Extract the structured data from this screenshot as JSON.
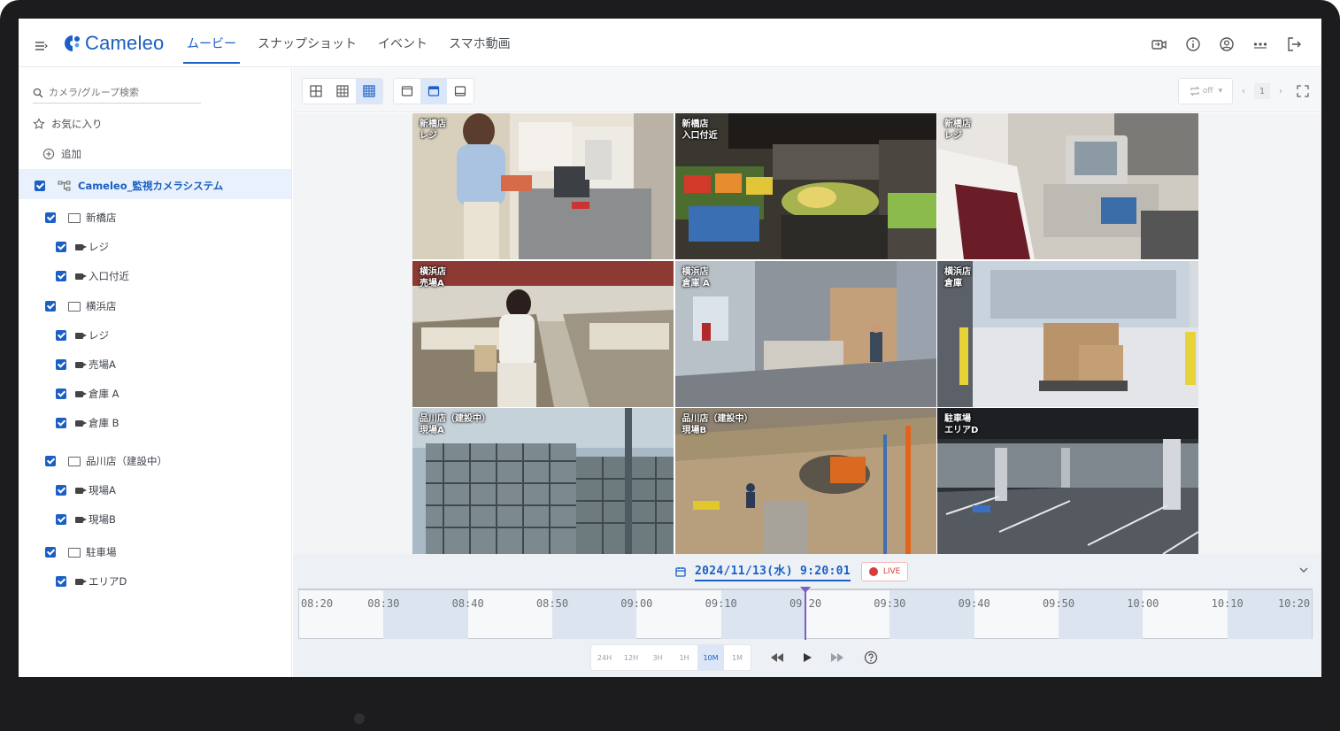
{
  "app": {
    "logo_text": "Cameleo"
  },
  "nav": {
    "tabs": [
      {
        "label": "ムービー",
        "active": true
      },
      {
        "label": "スナップショット",
        "active": false
      },
      {
        "label": "イベント",
        "active": false
      },
      {
        "label": "スマホ動画",
        "active": false
      }
    ]
  },
  "header_icons": [
    "camera-switch-icon",
    "info-icon",
    "account-icon",
    "more-icon",
    "logout-icon"
  ],
  "sidebar": {
    "search_placeholder": "カメラ/グループ検索",
    "favorites_label": "お気に入り",
    "add_label": "追加",
    "root_label": "Cameleo_監視カメラシステム",
    "groups": [
      {
        "name": "新橋店",
        "cameras": [
          "レジ",
          "入口付近"
        ]
      },
      {
        "name": "横浜店",
        "cameras": [
          "レジ",
          "売場A",
          "倉庫 A",
          "倉庫 B"
        ]
      },
      {
        "name": "品川店（建設中）",
        "cameras": [
          "現場A",
          "現場B"
        ]
      },
      {
        "name": "駐車場",
        "cameras": [
          "エリアD"
        ]
      }
    ]
  },
  "toolbar": {
    "layout_buttons": [
      "grid-2x2-icon",
      "grid-3x3-small-icon",
      "grid-3x3-icon"
    ],
    "active_layout": 2,
    "view_buttons": [
      "single-window-icon",
      "window-header-icon",
      "window-footer-icon"
    ],
    "active_view": 1,
    "rotate_label": "off",
    "page_number": "1"
  },
  "cameras_grid": [
    {
      "label": "新橋店\nレジ"
    },
    {
      "label": "新橋店\n入口付近"
    },
    {
      "label": "新橋店\nレジ"
    },
    {
      "label": "横浜店\n売場A"
    },
    {
      "label": "横浜店\n倉庫 A"
    },
    {
      "label": "横浜店\n倉庫"
    },
    {
      "label": "品川店（建設中）\n現場A"
    },
    {
      "label": "品川店（建設中）\n現場B"
    },
    {
      "label": "駐車場\nエリアD"
    }
  ],
  "timeline": {
    "datetime": "2024/11/13(水) 9:20:01",
    "live_label": "LIVE",
    "ticks": [
      "08:20",
      "08:30",
      "08:40",
      "08:50",
      "09:00",
      "09:10",
      "09:20",
      "09:30",
      "09:40",
      "09:50",
      "10:00",
      "10:10",
      "10:20"
    ],
    "current_tick_index": 6,
    "zoom_options": [
      "24H",
      "12H",
      "3H",
      "1H",
      "10M",
      "1M"
    ],
    "active_zoom": "10M",
    "colors": {
      "accent": "#1b5fc4",
      "live": "#d93a3a",
      "playhead": "#7860c8"
    }
  }
}
